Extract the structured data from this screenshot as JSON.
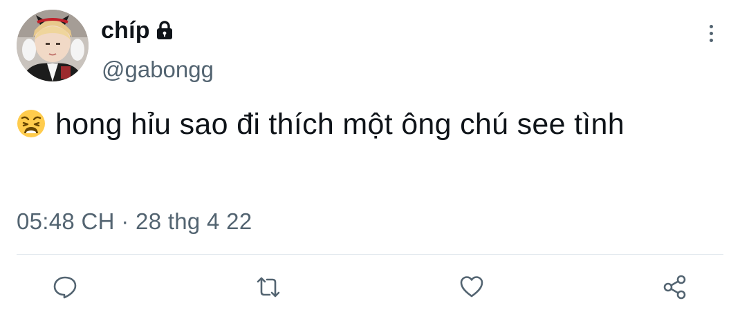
{
  "user": {
    "display_name": "chíp",
    "handle": "@gabongg",
    "protected_icon": "lock-icon"
  },
  "tweet": {
    "emoji": "weary-face-emoji",
    "text": "hong hỉu sao đi thích một ông chú see tình",
    "timestamp": "05:48 CH · 28 thg 4 22"
  },
  "actions": {
    "reply_icon": "reply-icon",
    "retweet_icon": "retweet-icon",
    "like_icon": "heart-icon",
    "share_icon": "share-icon"
  },
  "colors": {
    "text": "#0f1419",
    "secondary": "#536471",
    "divider": "#e1e8ed"
  }
}
